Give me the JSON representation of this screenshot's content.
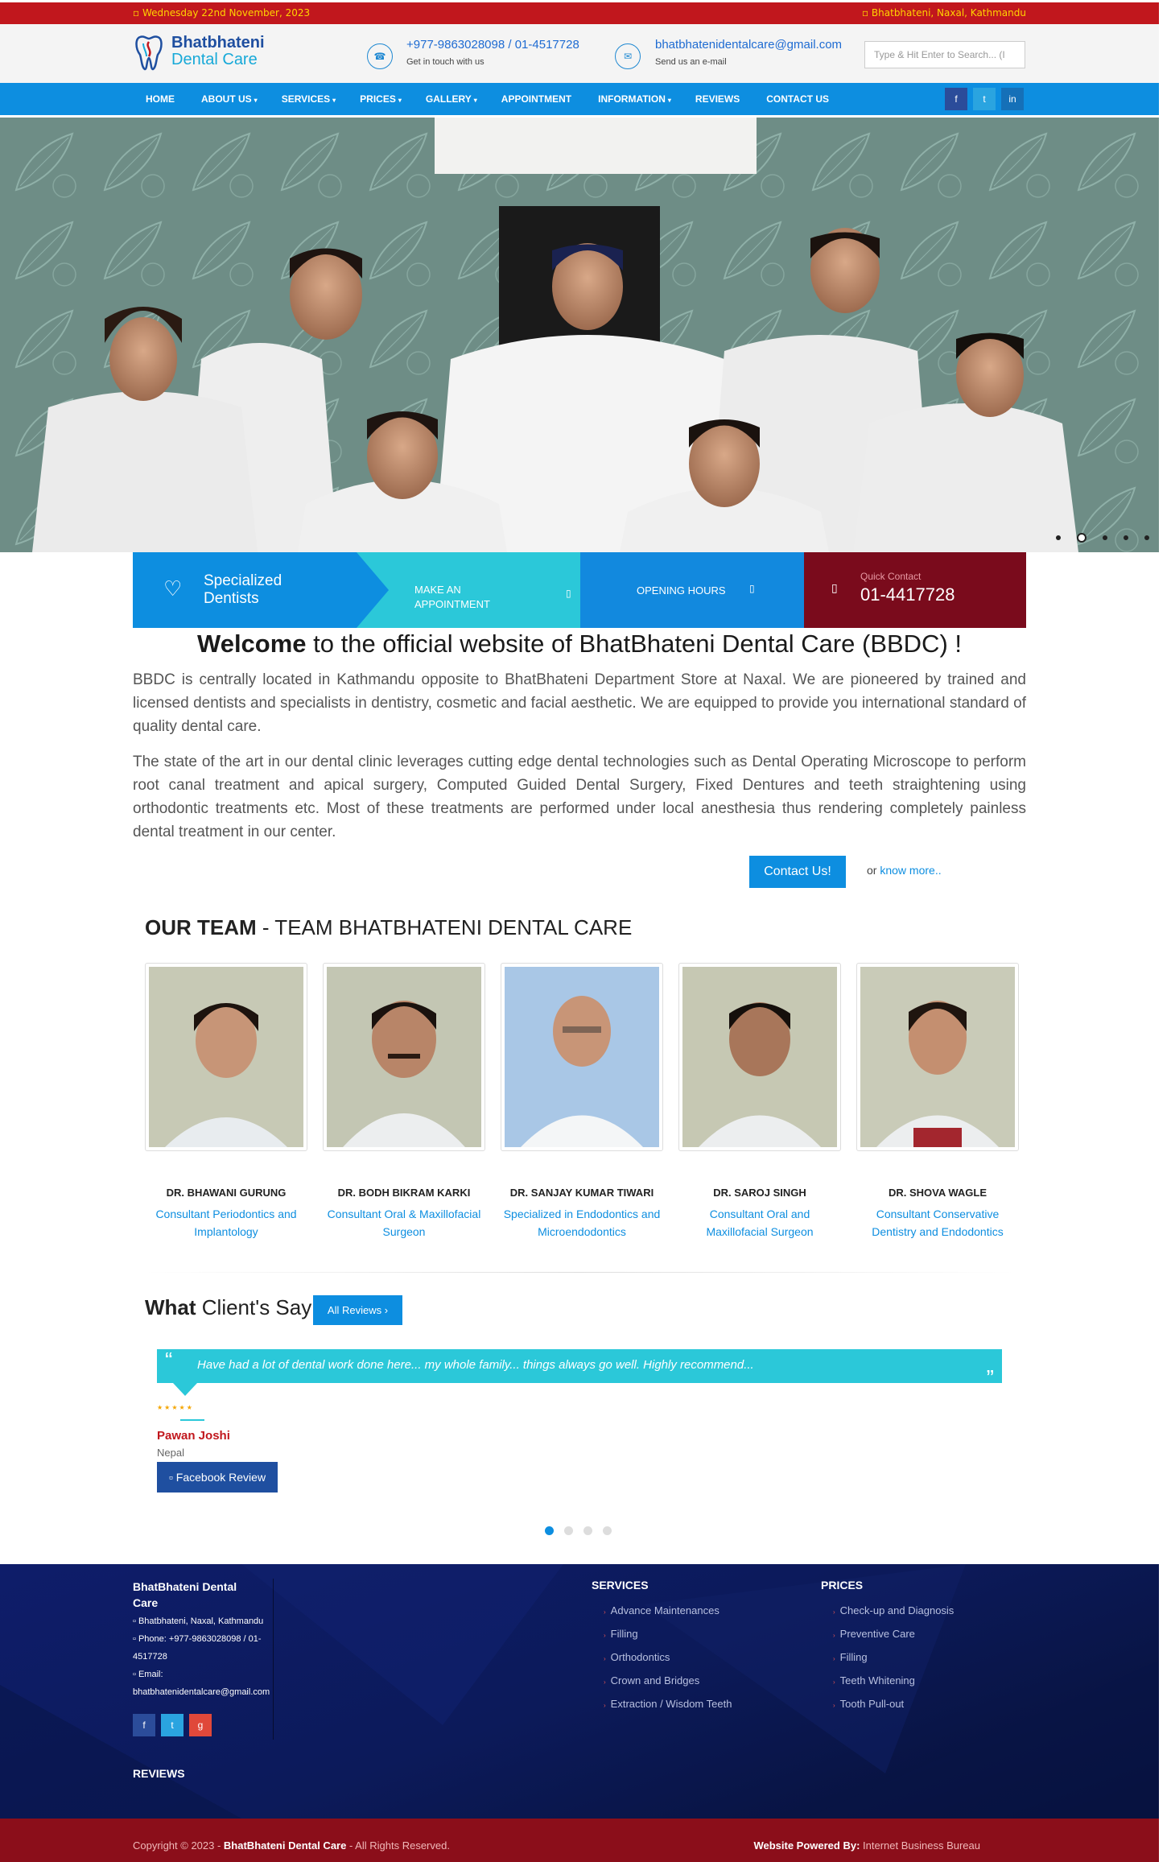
{
  "topbar": {
    "date": "Wednesday 22nd November, 2023",
    "address": "Bhatbhateni, Naxal, Kathmandu"
  },
  "header": {
    "logo_line1": "Bhatbhateni",
    "logo_line2": "Dental Care",
    "phone": "+977-9863028098 / 01-4517728",
    "phone_sub": "Get in touch with us",
    "email": "bhatbhatenidentalcare@gmail.com",
    "email_sub": "Send us an e-mail",
    "search_placeholder": "Type & Hit Enter to Search... (I"
  },
  "nav": {
    "items": [
      {
        "label": "HOME",
        "caret": ""
      },
      {
        "label": "ABOUT US",
        "caret": "▾"
      },
      {
        "label": "SERVICES",
        "caret": "▾"
      },
      {
        "label": "PRICES",
        "caret": "▾"
      },
      {
        "label": "GALLERY",
        "caret": "▾"
      },
      {
        "label": "APPOINTMENT",
        "caret": ""
      },
      {
        "label": "INFORMATION",
        "caret": "▾"
      },
      {
        "label": "REVIEWS",
        "caret": ""
      },
      {
        "label": "CONTACT US",
        "caret": ""
      }
    ],
    "social": [
      "f",
      "t",
      "in"
    ]
  },
  "features": {
    "specialized_line1": "Specialized",
    "specialized_line2": "Dentists",
    "appointment_line1": "MAKE AN",
    "appointment_line2": "APPOINTMENT",
    "opening": "OPENING HOURS",
    "quick_label": "Quick Contact",
    "quick_phone": "01-4417728"
  },
  "welcome": {
    "bold": "Welcome",
    "rest": " to the official website of BhatBhateni Dental Care (BBDC) !",
    "p1": "BBDC is centrally located in Kathmandu opposite to BhatBhateni Department Store at Naxal. We are pioneered by trained and licensed dentists and specialists in dentistry, cosmetic and facial aesthetic. We are equipped to provide you international standard of quality dental care.",
    "p2": "The state of the art in our dental clinic leverages cutting edge dental technologies such as Dental Operating Microscope to perform root canal treatment and apical surgery, Computed Guided Dental Surgery, Fixed Dentures and teeth straightening using orthodontic treatments etc. Most of these treatments are performed under local anesthesia thus rendering completely painless dental treatment in our center.",
    "contact_button": "Contact Us!",
    "or_text": "or",
    "know_more": "know more.."
  },
  "team": {
    "title_bold": "OUR TEAM",
    "title_rest": " - TEAM BHATBHATENI DENTAL CARE",
    "members": [
      {
        "name": "DR. BHAWANI GURUNG",
        "role": "Consultant Periodontics and Implantology"
      },
      {
        "name": "DR. BODH BIKRAM KARKI",
        "role": "Consultant Oral & Maxillofacial Surgeon"
      },
      {
        "name": "DR. SANJAY KUMAR TIWARI",
        "role": "Specialized in Endodontics and Microendodontics"
      },
      {
        "name": "DR. SAROJ SINGH",
        "role": "Consultant Oral and Maxillofacial Surgeon"
      },
      {
        "name": "DR. SHOVA WAGLE",
        "role": "Consultant Conservative Dentistry and Endodontics"
      }
    ]
  },
  "reviews": {
    "title_bold": "What",
    "title_rest": " Client's Say -",
    "all_button": "All Reviews",
    "quote": "Have had a lot of dental work done here... my whole family... things always go well. Highly recommend...",
    "stars": "★★★★★",
    "name": "Pawan Joshi",
    "country": "Nepal",
    "fb_button": "Facebook Review"
  },
  "footer": {
    "org": "BhatBhateni Dental Care",
    "address": "Bhatbhateni, Naxal, Kathmandu",
    "phone": "Phone: +977-9863028098 / 01-4517728",
    "email_label": "Email:",
    "email": "bhatbhatenidentalcare@gmail.com",
    "services_title": "SERVICES",
    "services": [
      "Advance Maintenances",
      "Filling",
      "Orthodontics",
      "Crown and Bridges",
      "Extraction / Wisdom Teeth"
    ],
    "prices_title": "PRICES",
    "prices": [
      "Check-up and Diagnosis",
      "Preventive Care",
      "Filling",
      "Teeth Whitening",
      "Tooth Pull-out"
    ],
    "reviews_title": "REVIEWS",
    "copyright_prefix": "Copyright © 2023 - ",
    "copyright_org": "BhatBhateni Dental Care",
    "copyright_suffix": " - All Rights Reserved.",
    "powered_label": "Website Powered By:",
    "powered_by": " Internet Business Bureau"
  },
  "colors": {
    "brand_red": "#c1171d",
    "brand_blue": "#0d8ee0",
    "accent_cyan": "#2bc8d9",
    "dark_navy": "#0c1a5a",
    "maroon": "#7a0b1c"
  }
}
